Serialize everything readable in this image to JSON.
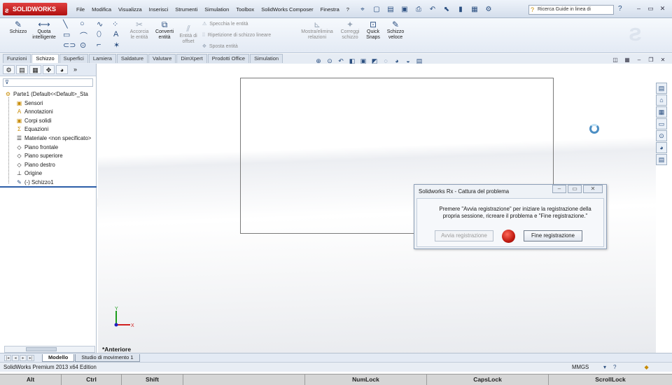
{
  "app": {
    "logo": "SOLIDWORKS"
  },
  "menu": [
    "File",
    "Modifica",
    "Visualizza",
    "Inserisci",
    "Strumenti",
    "Simulation",
    "Toolbox",
    "SolidWorks Composer",
    "Finestra",
    "?"
  ],
  "search": {
    "placeholder": "Ricerca Guide in linea di"
  },
  "window_controls": [
    "?",
    "–",
    "▭",
    "✕"
  ],
  "commands": {
    "schizzo": "Schizzo",
    "quota_1": "Quota",
    "quota_2": "intelligente",
    "accorda_1": "Accorcia",
    "accorda_2": "le entità",
    "converti_1": "Converti",
    "converti_2": "entità",
    "offset_1": "Entità di",
    "offset_2": "offset",
    "specchia": "Specchia le entità",
    "ripetizione": "Ripetizione di schizzo lineare",
    "sposta": "Sposta entità",
    "mostra_1": "Mostra/elimina",
    "mostra_2": "relazioni",
    "correggi_1": "Correggi",
    "correggi_2": "schizzo",
    "quick_1": "Quick",
    "quick_2": "Snaps",
    "veloce_1": "Schizzo",
    "veloce_2": "veloce"
  },
  "tabs": [
    "Funzioni",
    "Schizzo",
    "Superfici",
    "Lamiera",
    "Saldature",
    "Valutare",
    "DimXpert",
    "Prodotti Office",
    "Simulation"
  ],
  "active_tab": "Schizzo",
  "tree": {
    "root": "Parte1  (Default<<Default>_Sta",
    "items": [
      "Sensori",
      "Annotazioni",
      "Corpi solidi",
      "Equazioni",
      "Materiale <non specificato>",
      "Piano frontale",
      "Piano superiore",
      "Piano destro",
      "Origine",
      "(-) Schizzo1"
    ]
  },
  "viewport": {
    "view_name": "*Anteriore",
    "triad_x": "X",
    "triad_y": "Y"
  },
  "dialog": {
    "title": "Solidworks Rx - Cattura del problema",
    "message": "Premere \"Avvia registrazione\" per iniziare la registrazione della propria sessione, ricreare il problema e \"Fine registrazione.\"",
    "start_label": "Avvia registrazione",
    "stop_label": "Fine registrazione"
  },
  "bottom_tabs": [
    "Modello",
    "Studio di movimento 1"
  ],
  "status": {
    "text": "SolidWorks Premium 2013 x64 Edition",
    "units": "MMGS"
  },
  "keys": [
    "Alt",
    "Ctrl",
    "Shift",
    "",
    "NumLock",
    "CapsLock",
    "ScrollLock"
  ],
  "colors": {
    "brand_red": "#c8201a",
    "accent_blue": "#2d5ea8"
  }
}
